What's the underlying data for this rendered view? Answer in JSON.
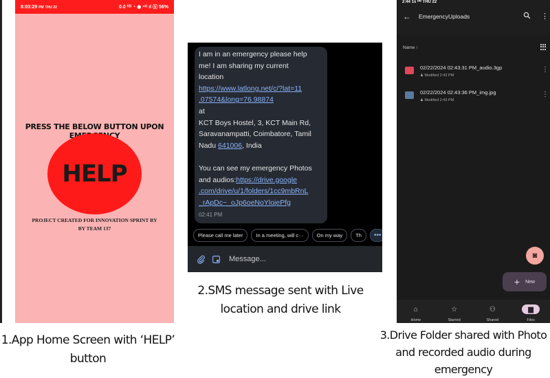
{
  "panel1": {
    "status": {
      "time": "8:03:29",
      "ampm": "PM",
      "day": "THU 22",
      "icons": "0.0 ᴷᴮ ◔ ◉ ⁴ᴳ ıl ⓑ 56%"
    },
    "heading": "PRESS THE BELOW BUTTON UPON EMERGENCY",
    "help_label": "HELP",
    "project_line1": "PROJECT CREATED FOR INNOVATION SPRINT BY",
    "project_line2": "BY TEAM 137",
    "colors": {
      "bg": "#fbb3b3",
      "status": "#ff1c1c",
      "button": "#ff1a1a"
    }
  },
  "panel2": {
    "message_lines": [
      "I am in an emergency please help",
      "me! I am sharing my current",
      "location"
    ],
    "link1_lines": [
      "https://www.latlong.net/c/?lat=11",
      ".07574&long=76.98874"
    ],
    "address_lines": [
      " at",
      "KCT Boys Hostel, 3, KCT Main Rd,",
      "Saravanampatti, Coimbatore, Tamil"
    ],
    "address_last_prefix": "Nadu ",
    "address_pin": "641006",
    "address_last_suffix": ", India",
    "photos_line1": "You can see my emergency Photos",
    "photos_prefix": "and audios:",
    "link2_first": "https://drive.google",
    "link2_lines": [
      ".com/drive/u/1/folders/1cc9mbRnL",
      "_rApDc~_oJp6oeNoYlojePfg"
    ],
    "time": "02:41 PM",
    "quick_replies": [
      "Please call me later",
      "In a meeting, will c···",
      "On my way",
      "Th"
    ],
    "more_label": "•••",
    "compose_placeholder": "Message...",
    "icons": {
      "attach": "paperclip-icon",
      "gallery": "gallery-icon",
      "more": "more-icon"
    }
  },
  "panel3": {
    "status": "2:44 1s ᴿᴹ THU 22",
    "title": "EmergencyUploads",
    "sort_label": "Name ↑",
    "files": [
      {
        "name": "02/22/2024 02:43:31 PM_audio.3gp",
        "meta": "Modified 2:43 PM",
        "icon_color": "#e0485a"
      },
      {
        "name": "02/22/2024 02:43:36 PM_img.jpg",
        "meta": "Modified 2:43 PM",
        "icon_color": "#5a7aa0"
      }
    ],
    "new_label": "New",
    "nav": [
      {
        "label": "Home",
        "icon": "⌂"
      },
      {
        "label": "Starred",
        "icon": "☆"
      },
      {
        "label": "Shared",
        "icon": "⚇"
      },
      {
        "label": "Files",
        "icon": "▆"
      }
    ]
  },
  "captions": {
    "cap1": [
      "1.App Home Screen with ‘HELP’",
      "button"
    ],
    "cap2": [
      "2.SMS message sent with Live",
      "location and drive link"
    ],
    "cap3": [
      "3.Drive Folder shared with Photo",
      "and recorded audio during",
      "emergency"
    ]
  }
}
